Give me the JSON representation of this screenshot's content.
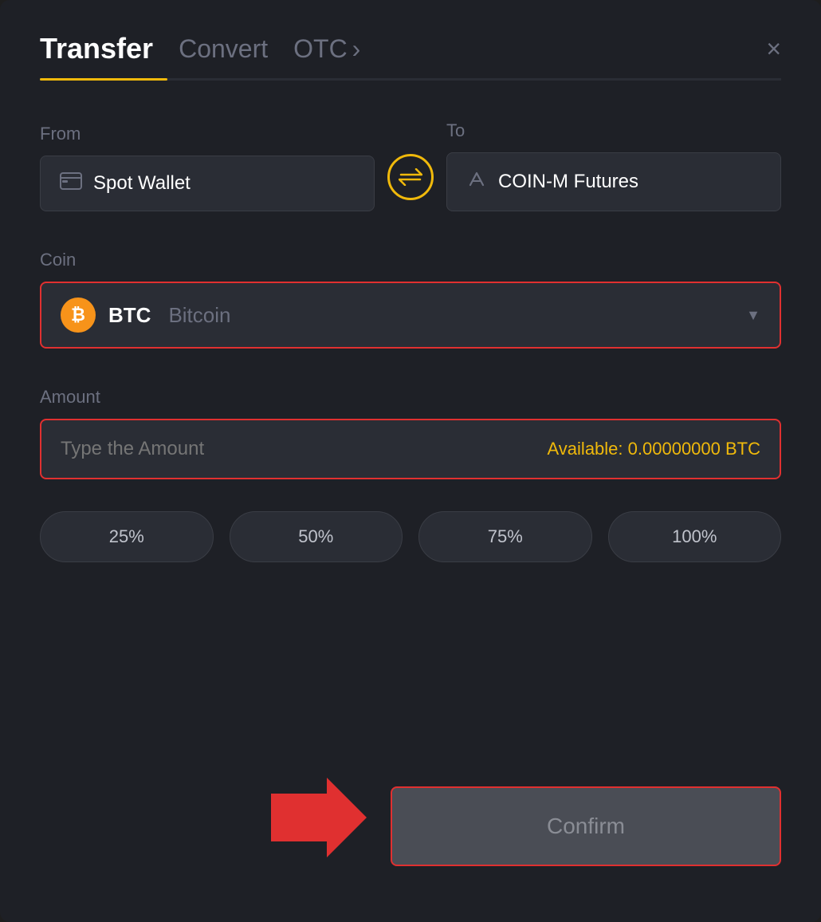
{
  "header": {
    "tab_transfer": "Transfer",
    "tab_convert": "Convert",
    "tab_otc": "OTC",
    "tab_otc_chevron": "›",
    "close_label": "×"
  },
  "from": {
    "label": "From",
    "wallet_icon": "🪪",
    "wallet_text": "Spot Wallet"
  },
  "to": {
    "label": "To",
    "futures_icon": "↑",
    "futures_text": "COIN-M Futures"
  },
  "swap": {
    "icon": "⇄"
  },
  "coin": {
    "label": "Coin",
    "name": "BTC",
    "full_name": "Bitcoin",
    "chevron": "▼"
  },
  "amount": {
    "label": "Amount",
    "placeholder": "Type the Amount",
    "available_label": "Available:",
    "available_value": "0.00000000 BTC"
  },
  "percentages": [
    {
      "label": "25%"
    },
    {
      "label": "50%"
    },
    {
      "label": "75%"
    },
    {
      "label": "100%"
    }
  ],
  "confirm": {
    "label": "Confirm"
  }
}
